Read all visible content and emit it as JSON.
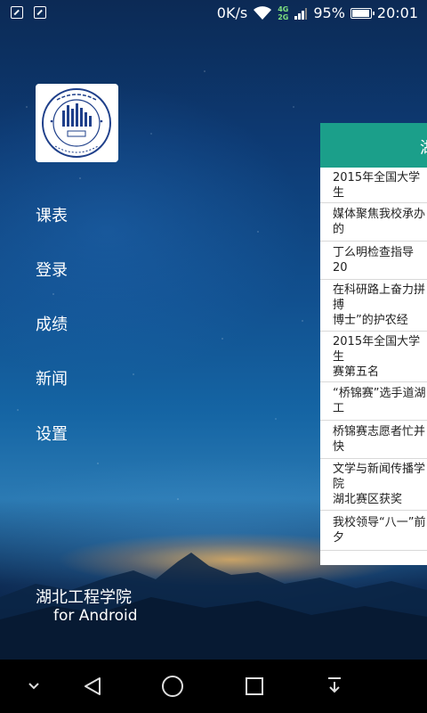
{
  "status_bar": {
    "left_icons": [
      "edit-icon",
      "image-icon"
    ],
    "speed": "0K/s",
    "network_4g": "4G",
    "network_2g": "2G",
    "battery_percent": "95%",
    "time": "20:01"
  },
  "drawer": {
    "logo_icon": "university-logo",
    "menu_items": [
      "课表",
      "登录",
      "成绩",
      "新闻",
      "设置"
    ],
    "footer_title": "湖北工程学院",
    "footer_subtitle": "for Android"
  },
  "news_panel": {
    "header_title": "湖",
    "header_color": "#1b9f8a",
    "items": [
      "2015年全国大学生",
      "媒体聚焦我校承办的",
      "丁么明检查指导20",
      "在科研路上奋力拼搏\n博士”的护农经",
      "2015年全国大学生\n赛第五名",
      "“桥锦赛”选手道湖工",
      "桥锦赛志愿者忙并快",
      "文学与新闻传播学院\n湖北赛区获奖",
      "我校领导“八一”前夕"
    ]
  },
  "nav_bar": {
    "icons": [
      "chevron-down-icon",
      "back-icon",
      "home-icon",
      "recents-icon",
      "notification-pull-icon"
    ]
  }
}
